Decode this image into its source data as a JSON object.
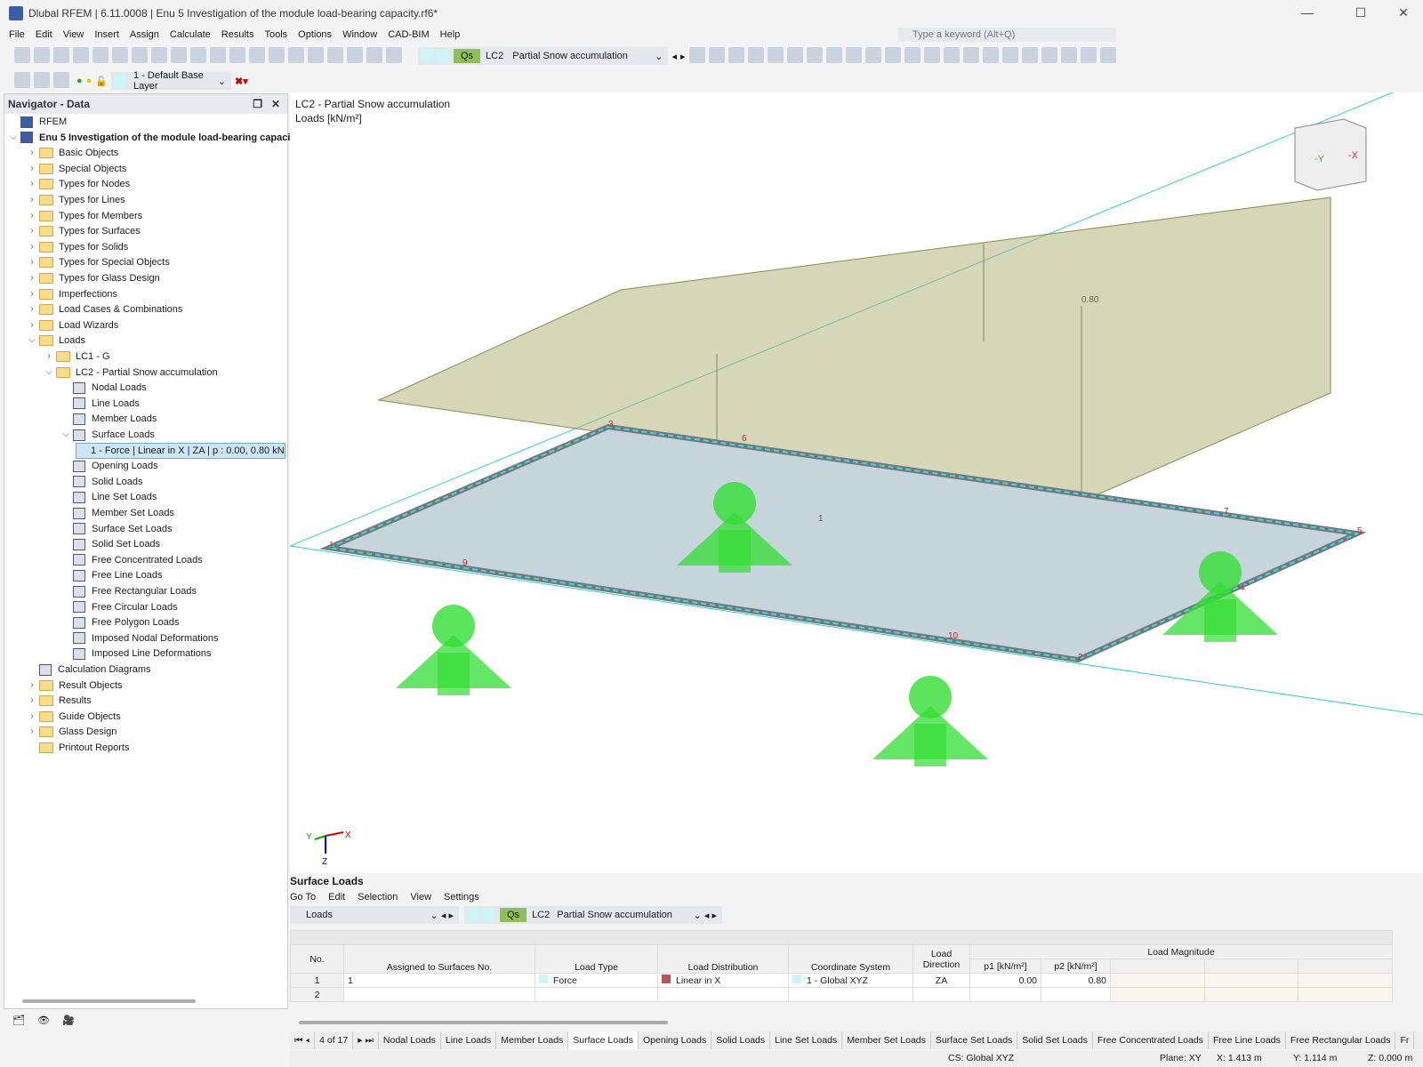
{
  "window": {
    "title": "Dlubal RFEM | 6.11.0008 | Enu 5 Investigation of the module load-bearing capacity.rf6*"
  },
  "menu": [
    "File",
    "Edit",
    "View",
    "Insert",
    "Assign",
    "Calculate",
    "Results",
    "Tools",
    "Options",
    "Window",
    "CAD-BIM",
    "Help"
  ],
  "search": {
    "placeholder": "Type a keyword (Alt+Q)"
  },
  "toolbar": {
    "lc_badge": "Qs",
    "lc_id": "LC2",
    "lc_name": "Partial Snow accumulation",
    "layer": "1 - Default Base Layer"
  },
  "navigator": {
    "title": "Navigator - Data",
    "items": [
      {
        "l": "RFEM",
        "lvl": 0,
        "t": "app"
      },
      {
        "l": "Enu 5 Investigation of the module load-bearing capaci",
        "lvl": 0,
        "t": "model",
        "c": "v",
        "b": true
      },
      {
        "l": "Basic Objects",
        "lvl": 1,
        "t": "f",
        "c": ">"
      },
      {
        "l": "Special Objects",
        "lvl": 1,
        "t": "f",
        "c": ">"
      },
      {
        "l": "Types for Nodes",
        "lvl": 1,
        "t": "f",
        "c": ">"
      },
      {
        "l": "Types for Lines",
        "lvl": 1,
        "t": "f",
        "c": ">"
      },
      {
        "l": "Types for Members",
        "lvl": 1,
        "t": "f",
        "c": ">"
      },
      {
        "l": "Types for Surfaces",
        "lvl": 1,
        "t": "f",
        "c": ">"
      },
      {
        "l": "Types for Solids",
        "lvl": 1,
        "t": "f",
        "c": ">"
      },
      {
        "l": "Types for Special Objects",
        "lvl": 1,
        "t": "f",
        "c": ">"
      },
      {
        "l": "Types for Glass Design",
        "lvl": 1,
        "t": "f",
        "c": ">"
      },
      {
        "l": "Imperfections",
        "lvl": 1,
        "t": "f",
        "c": ">"
      },
      {
        "l": "Load Cases & Combinations",
        "lvl": 1,
        "t": "f",
        "c": ">"
      },
      {
        "l": "Load Wizards",
        "lvl": 1,
        "t": "f",
        "c": ">"
      },
      {
        "l": "Loads",
        "lvl": 1,
        "t": "f",
        "c": "v"
      },
      {
        "l": "LC1 - G",
        "lvl": 2,
        "t": "f",
        "c": ">"
      },
      {
        "l": "LC2 - Partial Snow accumulation",
        "lvl": 2,
        "t": "f",
        "c": "v"
      },
      {
        "l": "Nodal Loads",
        "lvl": 3,
        "t": "i"
      },
      {
        "l": "Line Loads",
        "lvl": 3,
        "t": "i"
      },
      {
        "l": "Member Loads",
        "lvl": 3,
        "t": "i"
      },
      {
        "l": "Surface Loads",
        "lvl": 3,
        "t": "i",
        "c": "v"
      },
      {
        "l": "1 - Force | Linear in X | ZA | p : 0.00, 0.80 kN",
        "lvl": 4,
        "t": "s"
      },
      {
        "l": "Opening Loads",
        "lvl": 3,
        "t": "i"
      },
      {
        "l": "Solid Loads",
        "lvl": 3,
        "t": "i"
      },
      {
        "l": "Line Set Loads",
        "lvl": 3,
        "t": "i"
      },
      {
        "l": "Member Set Loads",
        "lvl": 3,
        "t": "i"
      },
      {
        "l": "Surface Set Loads",
        "lvl": 3,
        "t": "i"
      },
      {
        "l": "Solid Set Loads",
        "lvl": 3,
        "t": "i"
      },
      {
        "l": "Free Concentrated Loads",
        "lvl": 3,
        "t": "i"
      },
      {
        "l": "Free Line Loads",
        "lvl": 3,
        "t": "i"
      },
      {
        "l": "Free Rectangular Loads",
        "lvl": 3,
        "t": "i"
      },
      {
        "l": "Free Circular Loads",
        "lvl": 3,
        "t": "i"
      },
      {
        "l": "Free Polygon Loads",
        "lvl": 3,
        "t": "i"
      },
      {
        "l": "Imposed Nodal Deformations",
        "lvl": 3,
        "t": "i"
      },
      {
        "l": "Imposed Line Deformations",
        "lvl": 3,
        "t": "i"
      },
      {
        "l": "Calculation Diagrams",
        "lvl": 1,
        "t": "i"
      },
      {
        "l": "Result Objects",
        "lvl": 1,
        "t": "f",
        "c": ">"
      },
      {
        "l": "Results",
        "lvl": 1,
        "t": "f",
        "c": ">"
      },
      {
        "l": "Guide Objects",
        "lvl": 1,
        "t": "f",
        "c": ">"
      },
      {
        "l": "Glass Design",
        "lvl": 1,
        "t": "f",
        "c": ">"
      },
      {
        "l": "Printout Reports",
        "lvl": 1,
        "t": "f"
      }
    ]
  },
  "viewport": {
    "title": "LC2 - Partial Snow accumulation",
    "units": "Loads [kN/m²]",
    "load_value": "0.80",
    "surface_label": "1",
    "line_labels": [
      "1",
      "2",
      "3",
      "4",
      "5"
    ],
    "node_labels": [
      "1",
      "2",
      "3",
      "4",
      "5",
      "6",
      "7",
      "9",
      "10"
    ],
    "axes": {
      "x": "X",
      "y": "Y",
      "z": "Z"
    },
    "cube": {
      "y": "-Y",
      "x": "-X"
    }
  },
  "panel": {
    "title": "Surface Loads",
    "menu": [
      "Go To",
      "Edit",
      "Selection",
      "View",
      "Settings"
    ],
    "category": "Loads",
    "lc_badge": "Qs",
    "lc_id": "LC2",
    "lc_name": "Partial Snow accumulation",
    "headers": {
      "no": "No.",
      "assigned": "Assigned to Surfaces No.",
      "type": "Load Type",
      "dist": "Load Distribution",
      "cs": "Coordinate System",
      "dir": "Load Direction",
      "mag": "Load Magnitude",
      "p1": "p1 [kN/m²]",
      "p2": "p2 [kN/m²]"
    },
    "rows": [
      {
        "no": "1",
        "assigned": "1",
        "type": "Force",
        "dist": "Linear in X",
        "cs": "1 - Global XYZ",
        "dir": "ZA",
        "p1": "0.00",
        "p2": "0.80"
      },
      {
        "no": "2"
      }
    ],
    "page": "4 of 17",
    "tabs": [
      "Nodal Loads",
      "Line Loads",
      "Member Loads",
      "Surface Loads",
      "Opening Loads",
      "Solid Loads",
      "Line Set Loads",
      "Member Set Loads",
      "Surface Set Loads",
      "Solid Set Loads",
      "Free Concentrated Loads",
      "Free Line Loads",
      "Free Rectangular Loads",
      "Fr"
    ],
    "active_tab": "Surface Loads"
  },
  "status": {
    "cs": "CS: Global XYZ",
    "plane": "Plane: XY",
    "x": "X: 1.413 m",
    "y": "Y: 1.114 m",
    "z": "Z: 0.000 m"
  },
  "colors": {
    "load": "#a8a870",
    "support": "#33dd33",
    "line": "#33ccdd"
  }
}
